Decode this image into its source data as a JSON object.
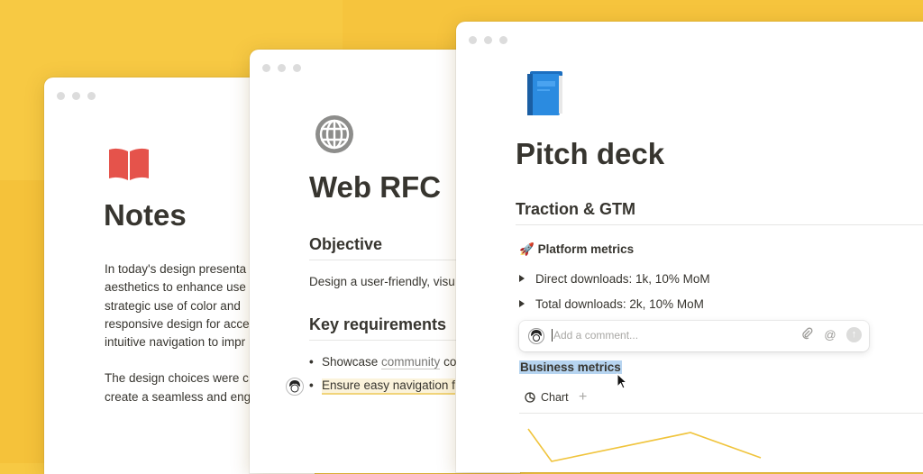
{
  "colors": {
    "background": "#f7c943",
    "chart_line": "#f0c43c",
    "selection": "#b6d4f0",
    "highlight_underline": "#f1d47a"
  },
  "notes_window": {
    "icon": "open-book-icon",
    "title": "Notes",
    "paragraph_lines_1": [
      "In today's design presenta",
      "aesthetics to enhance use",
      "strategic use of color and",
      "responsive design for acce",
      "intuitive navigation to impr"
    ],
    "paragraph_lines_2": [
      "The design choices were c",
      "create a seamless and eng"
    ]
  },
  "rfc_window": {
    "icon": "globe-icon",
    "title": "Web RFC",
    "objective_heading": "Objective",
    "objective_text": "Design a user-friendly, visu",
    "requirements_heading": "Key requirements",
    "bullet_1_pre": "Showcase ",
    "bullet_1_link": "community",
    "bullet_1_post": " co",
    "bullet_2": "Ensure easy navigation f"
  },
  "pitch_window": {
    "icon": "blue-book-icon",
    "title": "Pitch deck",
    "section_heading": "Traction & GTM",
    "metrics_emoji": "🚀",
    "metrics_heading": "Platform metrics",
    "toggle_1": "Direct downloads: 1k, 10% MoM",
    "toggle_2": "Total downloads: 2k, 10% MoM",
    "comment_placeholder": "Add a comment...",
    "selected_text": "Business metrics",
    "chart_tab_label": "Chart",
    "add_tab_symbol": "+"
  }
}
